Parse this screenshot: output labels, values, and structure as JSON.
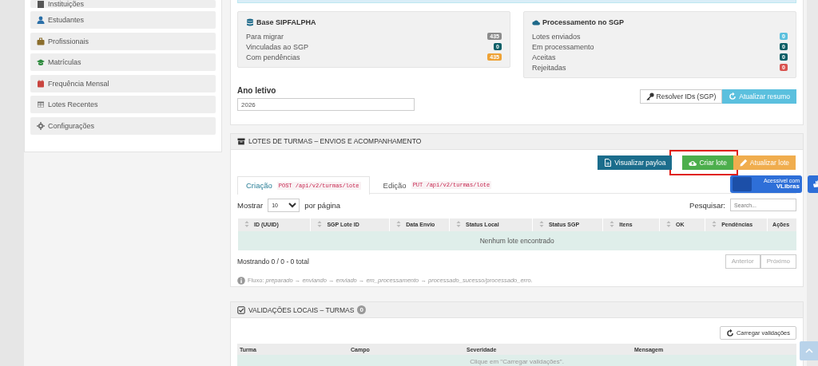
{
  "sidebar": {
    "items": [
      {
        "label": "Instituições"
      },
      {
        "label": "Estudantes"
      },
      {
        "label": "Profissionais"
      },
      {
        "label": "Matrículas"
      },
      {
        "label": "Frequência Mensal"
      },
      {
        "label": "Lotes Recentes"
      },
      {
        "label": "Configurações"
      }
    ]
  },
  "summary": {
    "cards": [
      {
        "title": "Base SIPFALPHA",
        "rows": [
          {
            "label": "Para migrar",
            "value": "435",
            "color": "#8c8c8c"
          },
          {
            "label": "Vinculadas ao SGP",
            "value": "0",
            "color": "#0b5e66"
          },
          {
            "label": "Com pendências",
            "value": "435",
            "color": "#eea236"
          }
        ]
      },
      {
        "title": "Processamento no SGP",
        "rows": [
          {
            "label": "Lotes enviados",
            "value": "0",
            "color": "#5bc0de"
          },
          {
            "label": "Em processamento",
            "value": "0",
            "color": "#0b5e66"
          },
          {
            "label": "Aceitas",
            "value": "0",
            "color": "#0b5e66"
          },
          {
            "label": "Rejeitadas",
            "value": "0",
            "color": "#d9534f"
          }
        ]
      }
    ],
    "year_label": "Ano letivo",
    "year_value": "2026",
    "buttons": [
      {
        "label": "Resolver IDs (SGP)",
        "kind": "default"
      },
      {
        "label": "Atualizar resumo",
        "kind": "info"
      }
    ]
  },
  "lotes": {
    "title": "LOTES DE TURMAS – ENVIOS E ACOMPANHAMENTO",
    "actions": [
      {
        "label": "Visualizar payloa",
        "kind": "primary"
      },
      {
        "label": "Criar lote",
        "kind": "success",
        "highlighted": true
      },
      {
        "label": "Atualizar lote",
        "kind": "warning"
      }
    ],
    "tabs": [
      {
        "label": "Criação",
        "method": "POST /api/v2/turmas/lote",
        "selected": true
      },
      {
        "label": "Edição",
        "method": "PUT /api/v2/turmas/lote",
        "selected": false
      }
    ],
    "length": {
      "before": "Mostrar",
      "value": "10",
      "after": "por página"
    },
    "search": {
      "label": "Pesquisar:",
      "placeholder": "Search..."
    },
    "columns": [
      {
        "label": "ID (UUID)",
        "sortable": true
      },
      {
        "label": "SGP Lote ID",
        "sortable": true
      },
      {
        "label": "Data Envio",
        "sortable": true
      },
      {
        "label": "Status Local",
        "sortable": true
      },
      {
        "label": "Status SGP",
        "sortable": true
      },
      {
        "label": "Itens",
        "sortable": true
      },
      {
        "label": "OK",
        "sortable": true
      },
      {
        "label": "Pendências",
        "sortable": true
      },
      {
        "label": "Ações",
        "sortable": false
      }
    ],
    "empty": "Nenhum lote encontrado",
    "info": "Mostrando 0 / 0 - 0 total",
    "pager": [
      {
        "label": "Anterior",
        "disabled": true
      },
      {
        "label": "Próximo",
        "disabled": true
      }
    ],
    "note": "Fluxo: *preparado → enviando → enviado → em_processamento → processado_sucesso/processado_erro.*"
  },
  "vlibras": {
    "line1": "Acessível com",
    "line2": "VLibras"
  },
  "validacoes": {
    "title": "VALIDAÇÕES LOCAIS – TURMAS",
    "count": "0",
    "button": "Carregar validações",
    "columns": [
      "Turma",
      "Campo",
      "Severidade",
      "Mensagem"
    ],
    "empty": "Clique em \"Carregar validações\"."
  }
}
